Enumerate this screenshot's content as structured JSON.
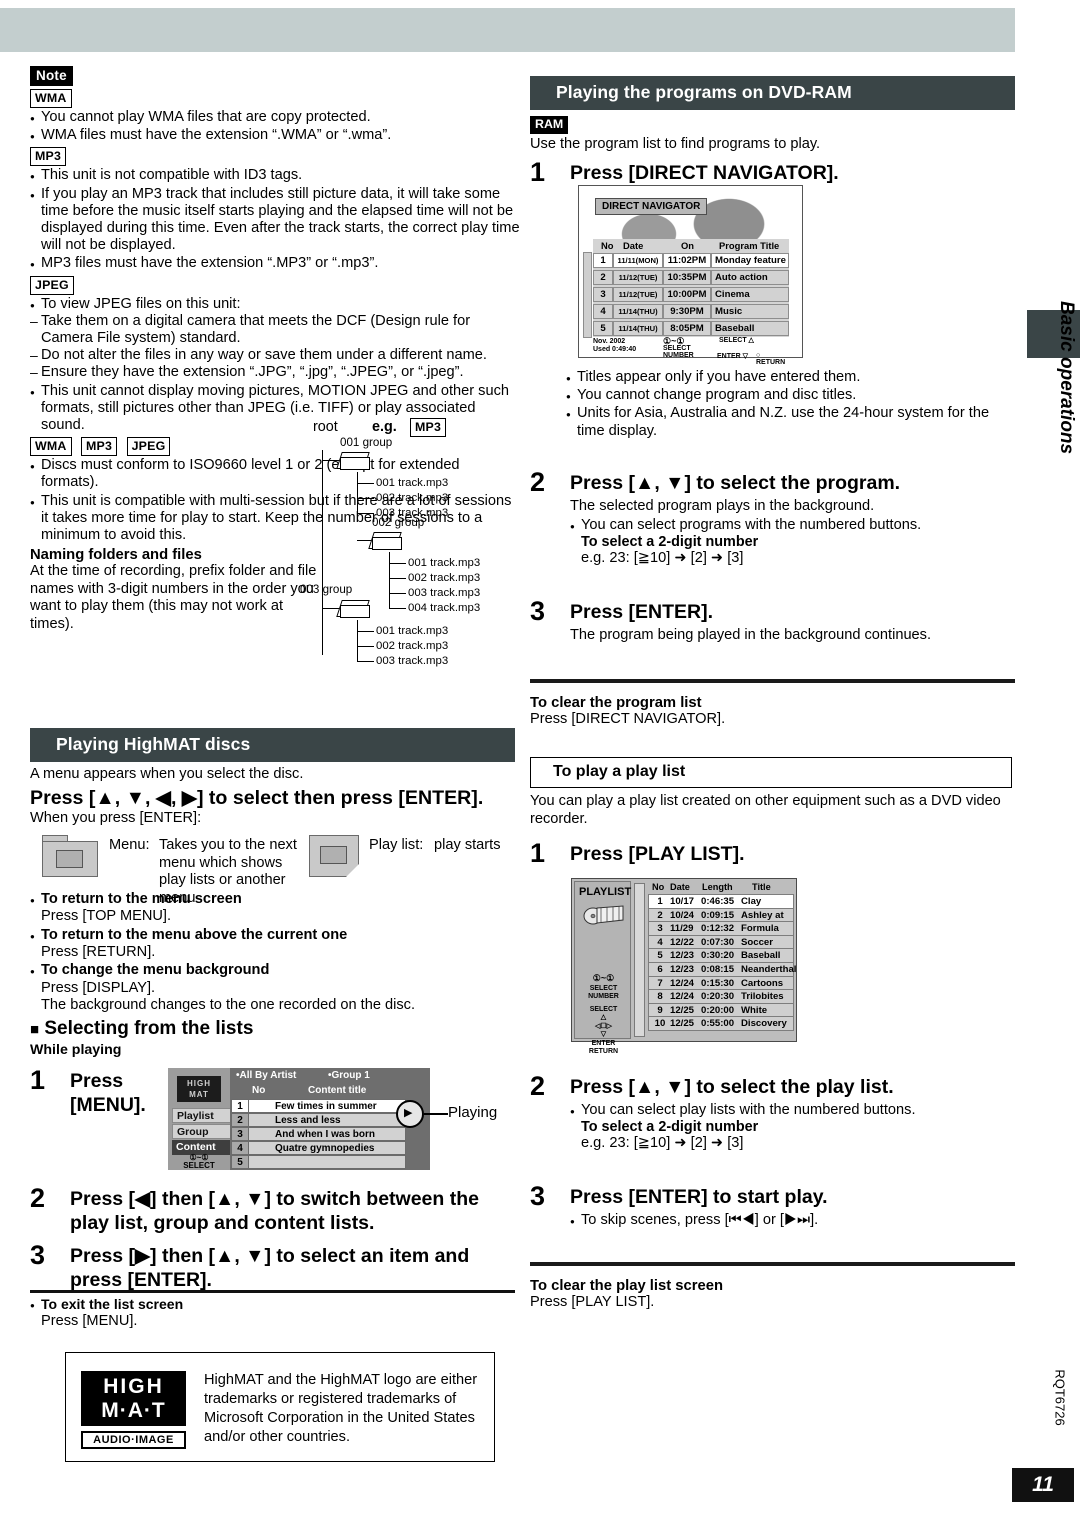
{
  "page": {
    "number": "11",
    "doc_code": "RQT6726",
    "side_tab_label": "Basic operations"
  },
  "left": {
    "note_tag": "Note",
    "wma_tag": "WMA",
    "wma_bullets": [
      "You cannot play WMA files that are copy protected.",
      "WMA files must have the extension “.WMA” or “.wma”."
    ],
    "mp3_tag": "MP3",
    "mp3_bullets": [
      "This unit is not compatible with ID3 tags.",
      "If you play an MP3 track that includes still picture data, it will take some time before the music itself starts playing and the elapsed time will not be displayed during this time. Even after the track starts, the correct play time will not be displayed.",
      "MP3 files must have the extension “.MP3” or “.mp3”."
    ],
    "jpeg_tag": "JPEG",
    "jpeg_lead": "To view JPEG files on this unit:",
    "jpeg_dashes": [
      "Take them on a digital camera that meets the DCF (Design rule for Camera File system) standard.",
      "Do not alter the files in any way or save them under a different name.",
      "Ensure they have the extension “.JPG”, “.jpg”, “.JPEG”, or “.jpeg”."
    ],
    "jpeg_bullet": "This unit cannot display moving pictures, MOTION JPEG and other such formats, still pictures other than JPEG (i.e. TIFF) or play associated sound.",
    "combo_tags": [
      "WMA",
      "MP3",
      "JPEG"
    ],
    "combo_bullets": [
      "Discs must conform to ISO9660 level 1 or 2 (except for extended formats).",
      "This unit is compatible with multi-session but if there are a lot of sessions it takes more time for play to start. Keep the number of sessions to a minimum to avoid this."
    ],
    "naming_title": "Naming folders and files",
    "naming_body": "At the time of recording, prefix folder and file names with 3-digit numbers in the order you want to play them (this may not work at times).",
    "tree": {
      "root_label": "root",
      "eg_label": "e.g.",
      "eg_tag": "MP3",
      "groups": [
        {
          "name": "001 group",
          "files": [
            "001 track.mp3",
            "002 track.mp3",
            "003 track.mp3"
          ]
        },
        {
          "name": "002 group",
          "files": [
            "001 track.mp3",
            "002 track.mp3",
            "003 track.mp3",
            "004 track.mp3"
          ]
        },
        {
          "name": "003 group",
          "files": [
            "001 track.mp3",
            "002 track.mp3",
            "003 track.mp3"
          ]
        }
      ]
    },
    "highmat": {
      "section_title": "Playing HighMAT discs",
      "intro": "A menu appears when you select the disc.",
      "instruction": "Press [▲, ▼, ◀, ▶] to select then press [ENTER].",
      "when_press": "When you press [ENTER]:",
      "menu_label": "Menu:",
      "menu_desc": "Takes you to the next menu which shows play lists or another menu",
      "playlist_label": "Play list:",
      "playlist_desc": "play starts",
      "tips": [
        {
          "title": "To return to the menu screen",
          "body": "Press [TOP MENU]."
        },
        {
          "title": "To return to the menu above the current one",
          "body": "Press [RETURN]."
        },
        {
          "title": "To change the menu background",
          "body": "Press [DISPLAY]."
        }
      ],
      "background_note": "The background changes to the one recorded on the disc."
    },
    "lists": {
      "title": "Selecting from the lists",
      "while_playing": "While playing",
      "steps": [
        {
          "num": "1",
          "head": "Press [MENU]."
        },
        {
          "num": "2",
          "head": "Press [◀] then [▲, ▼] to switch between the play list, group and content lists."
        },
        {
          "num": "3",
          "head": "Press [▶] then [▲, ▼] to select an item and press [ENTER]."
        }
      ],
      "exit_title": "To exit the list screen",
      "exit_body": "Press [MENU]."
    },
    "hm_screen": {
      "logo_line1": "HIGH",
      "logo_line2": "MAT",
      "buttons": [
        "Playlist",
        "Group",
        "Content"
      ],
      "select_keys": "①~①",
      "select_label": "SELECT",
      "tab_left": "•All By Artist",
      "tab_right": "•Group 1",
      "col_no": "No",
      "col_title": "Content title",
      "rows": [
        {
          "no": "1",
          "title": "Few times in summer"
        },
        {
          "no": "2",
          "title": "Less and less"
        },
        {
          "no": "3",
          "title": "And when I was born"
        },
        {
          "no": "4",
          "title": "Quatre gymnopedies"
        },
        {
          "no": "5",
          "title": ""
        }
      ],
      "playing_label": "Playing"
    },
    "trademark": {
      "logo_line1": "HIGH",
      "logo_line2": "M·A·T",
      "logo_sub": "AUDIO·IMAGE",
      "text": "HighMAT and the HighMAT logo are either trademarks or registered trademarks of Microsoft Corporation in the United States and/or other countries."
    }
  },
  "right": {
    "section_title": "Playing the programs on DVD-RAM",
    "ram_tag": "RAM",
    "intro": "Use the program list to find programs to play.",
    "steps": [
      {
        "num": "1",
        "head": "Press [DIRECT NAVIGATOR].",
        "bullets": [
          "Titles appear only if you have entered them.",
          "You cannot change program and disc titles.",
          "Units for Asia, Australia and N.Z. use the 24-hour system for the time display."
        ]
      },
      {
        "num": "2",
        "head": "Press [▲, ▼] to select the program.",
        "body": "The selected program plays in the background.",
        "bullets": [
          "You can select programs with the numbered buttons."
        ],
        "sub_title": "To select a 2-digit number",
        "sub_body": "e.g. 23: [≧10] ➜ [2] ➜ [3]"
      },
      {
        "num": "3",
        "head": "Press [ENTER].",
        "body": "The program being played in the background continues."
      }
    ],
    "clear_program_title": "To clear the program list",
    "clear_program_body": "Press [DIRECT NAVIGATOR].",
    "playlist_box_title": "To play a play list",
    "playlist_intro": "You can play a play list created on other equipment such as a DVD video recorder.",
    "pl_steps": [
      {
        "num": "1",
        "head": "Press [PLAY LIST]."
      },
      {
        "num": "2",
        "head": "Press [▲, ▼] to select the play list.",
        "bullets": [
          "You can select play lists with the numbered buttons."
        ],
        "sub_title": "To select a 2-digit number",
        "sub_body": "e.g. 23: [≧10] ➜ [2] ➜ [3]"
      },
      {
        "num": "3",
        "head": "Press [ENTER] to start play.",
        "bullets": [
          "To skip scenes, press [⏮◀] or [▶⏭]."
        ]
      }
    ],
    "clear_playlist_title": "To clear the play list screen",
    "clear_playlist_body": "Press [PLAY LIST].",
    "dn_screen": {
      "title": "DIRECT NAVIGATOR",
      "columns": [
        "No",
        "Date",
        "On",
        "Program Title"
      ],
      "rows": [
        {
          "no": "1",
          "date": "11/11(MON)",
          "on": "11:02PM",
          "title": "Monday feature"
        },
        {
          "no": "2",
          "date": "11/12(TUE)",
          "on": "10:35PM",
          "title": "Auto action"
        },
        {
          "no": "3",
          "date": "11/12(TUE)",
          "on": "10:00PM",
          "title": "Cinema"
        },
        {
          "no": "4",
          "date": "11/14(THU)",
          "on": "9:30PM",
          "title": "Music"
        },
        {
          "no": "5",
          "date": "11/14(THU)",
          "on": "8:05PM",
          "title": "Baseball"
        }
      ],
      "footer_left1": "Nov. 2002",
      "footer_left2": "Used 0:49:40",
      "footer_mid1": "①~①",
      "footer_mid2": "SELECT",
      "footer_mid3": "NUMBER",
      "footer_right1": "SELECT △",
      "footer_right2": "ENTER ▽",
      "footer_right3": "○ RETURN"
    },
    "pl_screen": {
      "title": "PLAYLIST",
      "columns": [
        "No",
        "Date",
        "Length",
        "Title"
      ],
      "rows": [
        {
          "no": "1",
          "date": "10/17",
          "length": "0:46:35",
          "title": "Clay Penguin"
        },
        {
          "no": "2",
          "date": "10/24",
          "length": "0:09:15",
          "title": "Ashley at Prom"
        },
        {
          "no": "3",
          "date": "11/29",
          "length": "0:12:32",
          "title": "Formula one"
        },
        {
          "no": "4",
          "date": "12/22",
          "length": "0:07:30",
          "title": "Soccer"
        },
        {
          "no": "5",
          "date": "12/23",
          "length": "0:30:20",
          "title": "Baseball"
        },
        {
          "no": "6",
          "date": "12/23",
          "length": "0:08:15",
          "title": "Neanderthal"
        },
        {
          "no": "7",
          "date": "12/24",
          "length": "0:15:30",
          "title": "Cartoons"
        },
        {
          "no": "8",
          "date": "12/24",
          "length": "0:20:30",
          "title": "Trilobites"
        },
        {
          "no": "9",
          "date": "12/25",
          "length": "0:20:00",
          "title": "White Dwarf"
        },
        {
          "no": "10",
          "date": "12/25",
          "length": "0:55:00",
          "title": "Discovery"
        }
      ],
      "keys1": "①~①",
      "keys2": "SELECT",
      "keys3": "NUMBER",
      "keys4": "SELECT",
      "keys5": "ENTER  RETURN"
    }
  }
}
